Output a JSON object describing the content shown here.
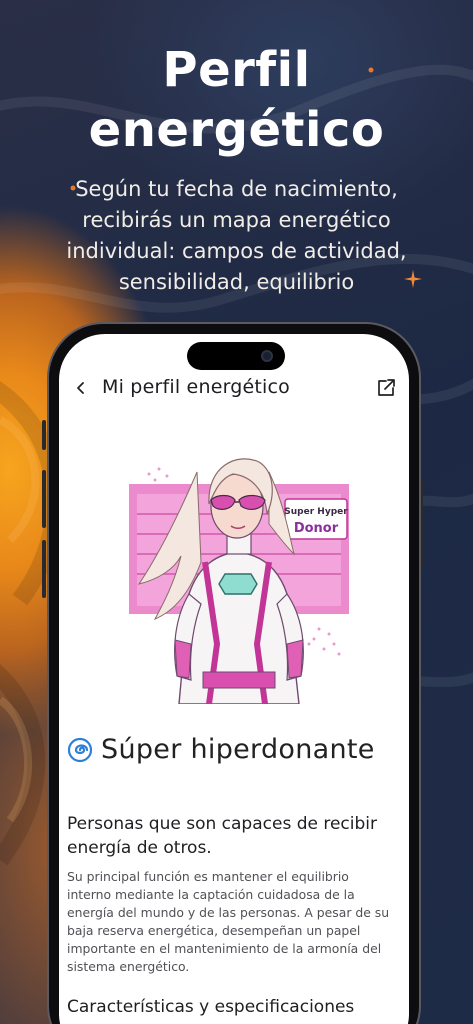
{
  "hero": {
    "title_line1": "Perfil",
    "title_line2": "energético",
    "subtitle": "Según tu fecha de nacimiento, recibirás un mapa energético individual: campos de actividad, sensibilidad, equilibrio"
  },
  "app": {
    "nav_title": "Mi perfil energético",
    "illustration_badge_line1": "Super Hyper",
    "illustration_badge_line2": "Donor",
    "type_name": "Súper hiperdonante",
    "section_heading": "Personas que son capaces de recibir energía de otros.",
    "description": "Su principal función es mantener el equilibrio interno mediante la captación cuidadosa de la energía del mundo y de las personas. A pesar de su baja reserva energética, desempeñan un papel importante en el mantenimiento de la armonía del sistema energético.",
    "next_heading": "Características y especificaciones"
  },
  "icons": {
    "back": "chevron-left-icon",
    "share": "share-icon",
    "type": "spiral-icon"
  },
  "colors": {
    "accent_pink": "#e04ab4",
    "spiral_blue": "#2e7fd8",
    "hero_orange": "#f7a51e",
    "bg_navy": "#1d2944"
  }
}
